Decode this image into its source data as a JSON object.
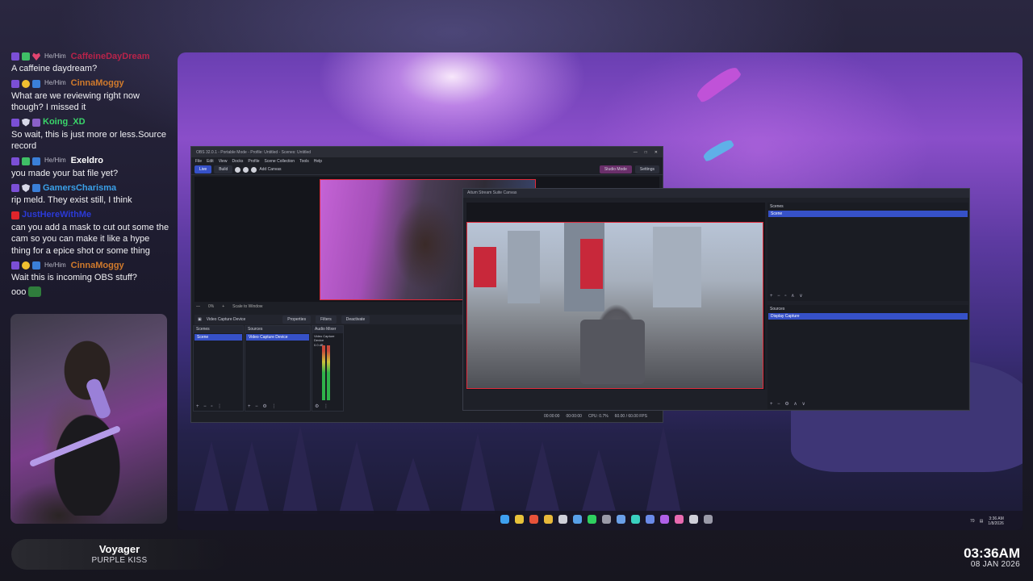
{
  "chat": {
    "messages": [
      {
        "pronouns": "He/Him",
        "user": "CaffeineDayDream",
        "color": "#b8234a",
        "text": "A caffeine daydream?",
        "badges": [
          "twitch",
          "green",
          "heart"
        ]
      },
      {
        "pronouns": "He/Him",
        "user": "CinnaMoggy",
        "color": "#d07a2c",
        "text": "What are we reviewing right now though? I missed it",
        "badges": [
          "twitch",
          "fire",
          "sub"
        ]
      },
      {
        "pronouns": "",
        "user": "Koing_XD",
        "color": "#3ad66a",
        "text": "So wait, this is just more or less.Source record",
        "badges": [
          "twitch",
          "shield",
          "game"
        ]
      },
      {
        "pronouns": "He/Him",
        "user": "Exeldro",
        "color": "#ffffff",
        "text": "you made your bat file yet?",
        "badges": [
          "twitch",
          "green",
          "sub"
        ]
      },
      {
        "pronouns": "",
        "user": "GamersCharisma",
        "color": "#3aa0e8",
        "text": "rip meld. They exist still, I think",
        "badges": [
          "twitch",
          "shield",
          "sub"
        ]
      },
      {
        "pronouns": "",
        "user": "JustHereWithMe",
        "color": "#2b3ad8",
        "text": "can you add a mask to cut out some the cam so you can make it like a hype thing for a epice shot or some thing",
        "badges": [
          "yt"
        ]
      },
      {
        "pronouns": "He/Him",
        "user": "CinnaMoggy",
        "color": "#d07a2c",
        "text": "Wait this is incoming OBS stuff?",
        "badges": [
          "twitch",
          "fire",
          "sub"
        ]
      },
      {
        "pronouns": "",
        "user": "",
        "color": "#ffffff",
        "text": "ooo",
        "badges": [],
        "emote": true
      }
    ]
  },
  "now_playing": {
    "song": "Voyager",
    "artist": "PURPLE KISS"
  },
  "clock": {
    "time": "03:36AM",
    "date": "08 JAN 2026"
  },
  "obs": {
    "title": "OBS 32.0.1 - Portable Mode - Profile: Untitled - Scenes: Untitled",
    "menu": [
      "File",
      "Edit",
      "View",
      "Docks",
      "Profile",
      "Scene Collection",
      "Tools",
      "Help"
    ],
    "mode_tabs": [
      "Live",
      "Build"
    ],
    "add_canvas": "Add Canvas",
    "studio_mode": "Studio Mode",
    "settings": "Settings",
    "zoom": "0%",
    "scale": "Scale to Window",
    "source_name": "Video Capture Device",
    "properties": "Properties",
    "filters": "Filters",
    "deactivate": "Deactivate",
    "docks": {
      "scenes": {
        "title": "Scenes",
        "items": [
          "Scene"
        ]
      },
      "sources": {
        "title": "Sources",
        "items": [
          "Video Capture Device"
        ]
      },
      "mixer": {
        "title": "Audio Mixer",
        "channel": "Video Capture Device",
        "level": "0.0 dB"
      }
    }
  },
  "projector": {
    "title": "Aitum Stream Suite Canvas",
    "scenes_title": "Scenes",
    "scene_item": "Scene",
    "sources_title": "Sources",
    "source_item": "Display Capture",
    "status": {
      "time1": "00:00:00",
      "time2": "00:00:00",
      "cpu": "CPU: 0.7%",
      "fps": "60.00 / 60.00 FPS"
    }
  },
  "taskbar": {
    "tray_number": "70",
    "tray_time": "3:36 AM",
    "tray_date": "1/8/2026",
    "icons": [
      "windows-icon",
      "chrome-icon",
      "chrome-icon",
      "folder-icon",
      "obs-icon",
      "app-icon",
      "spotify-icon",
      "app-icon",
      "app-icon",
      "app-icon",
      "app-icon",
      "app-icon",
      "app-icon",
      "obs-icon",
      "app-icon"
    ]
  }
}
